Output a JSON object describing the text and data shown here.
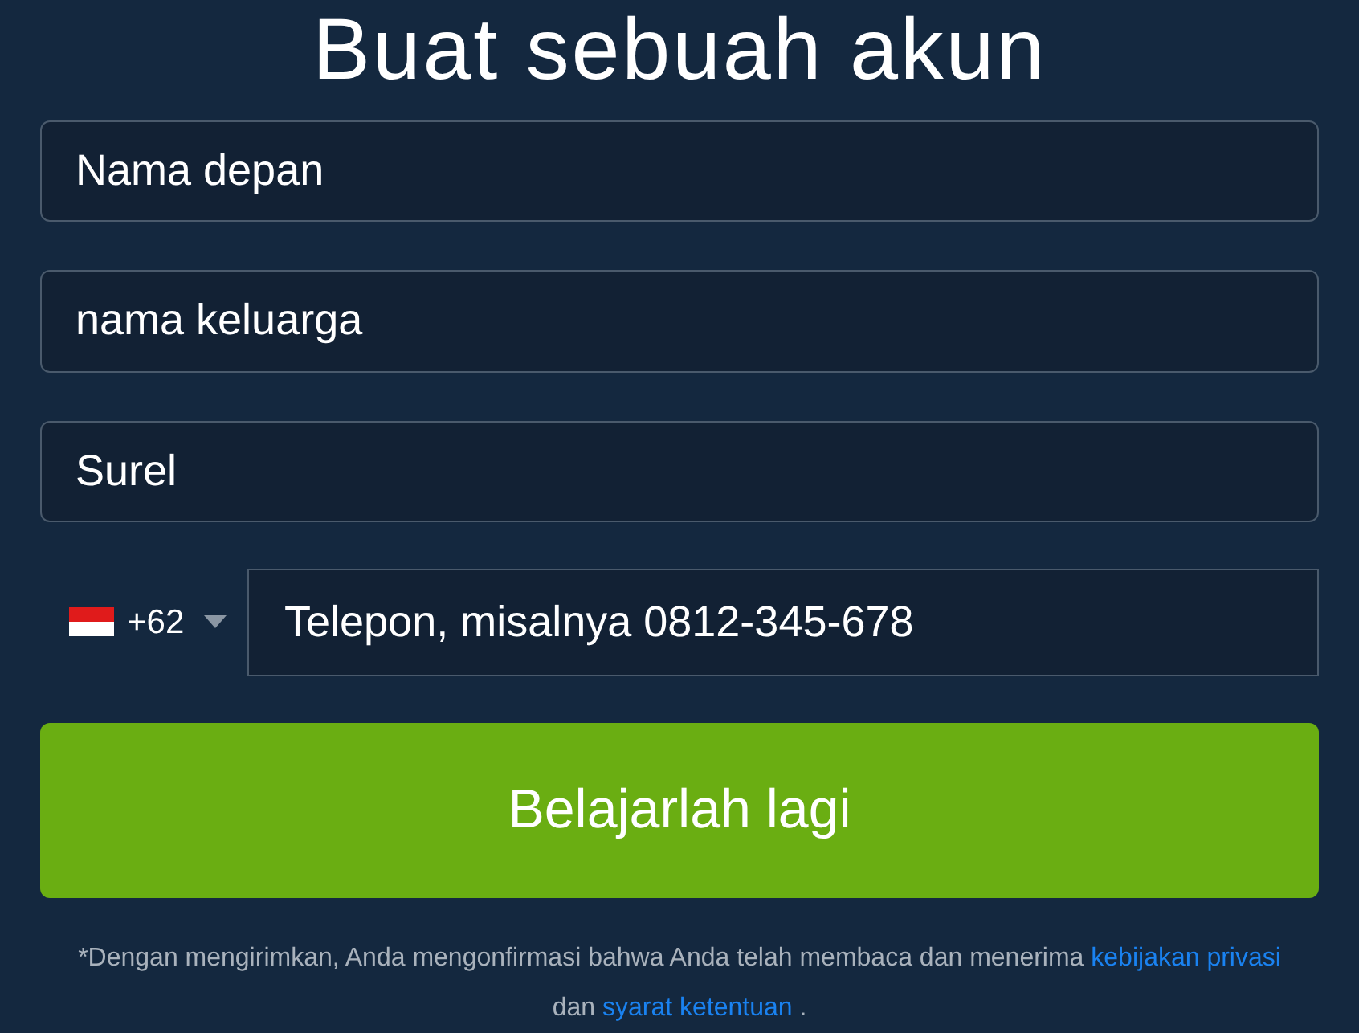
{
  "title": "Buat sebuah akun",
  "fields": [
    {
      "placeholder": "Nama depan"
    },
    {
      "placeholder": "nama keluarga"
    },
    {
      "placeholder": "Surel"
    }
  ],
  "phone": {
    "code": "+62",
    "placeholder": "Telepon, misalnya 0812-345-678"
  },
  "submit": "Belajarlah lagi",
  "consent": {
    "text": "*Dengan mengirimkan, Anda mengonfirmasi bahwa Anda telah membaca dan menerima",
    "link1": "kebijakan privasi",
    "middle": "dan",
    "link2": "syarat ketentuan",
    "end": "."
  }
}
